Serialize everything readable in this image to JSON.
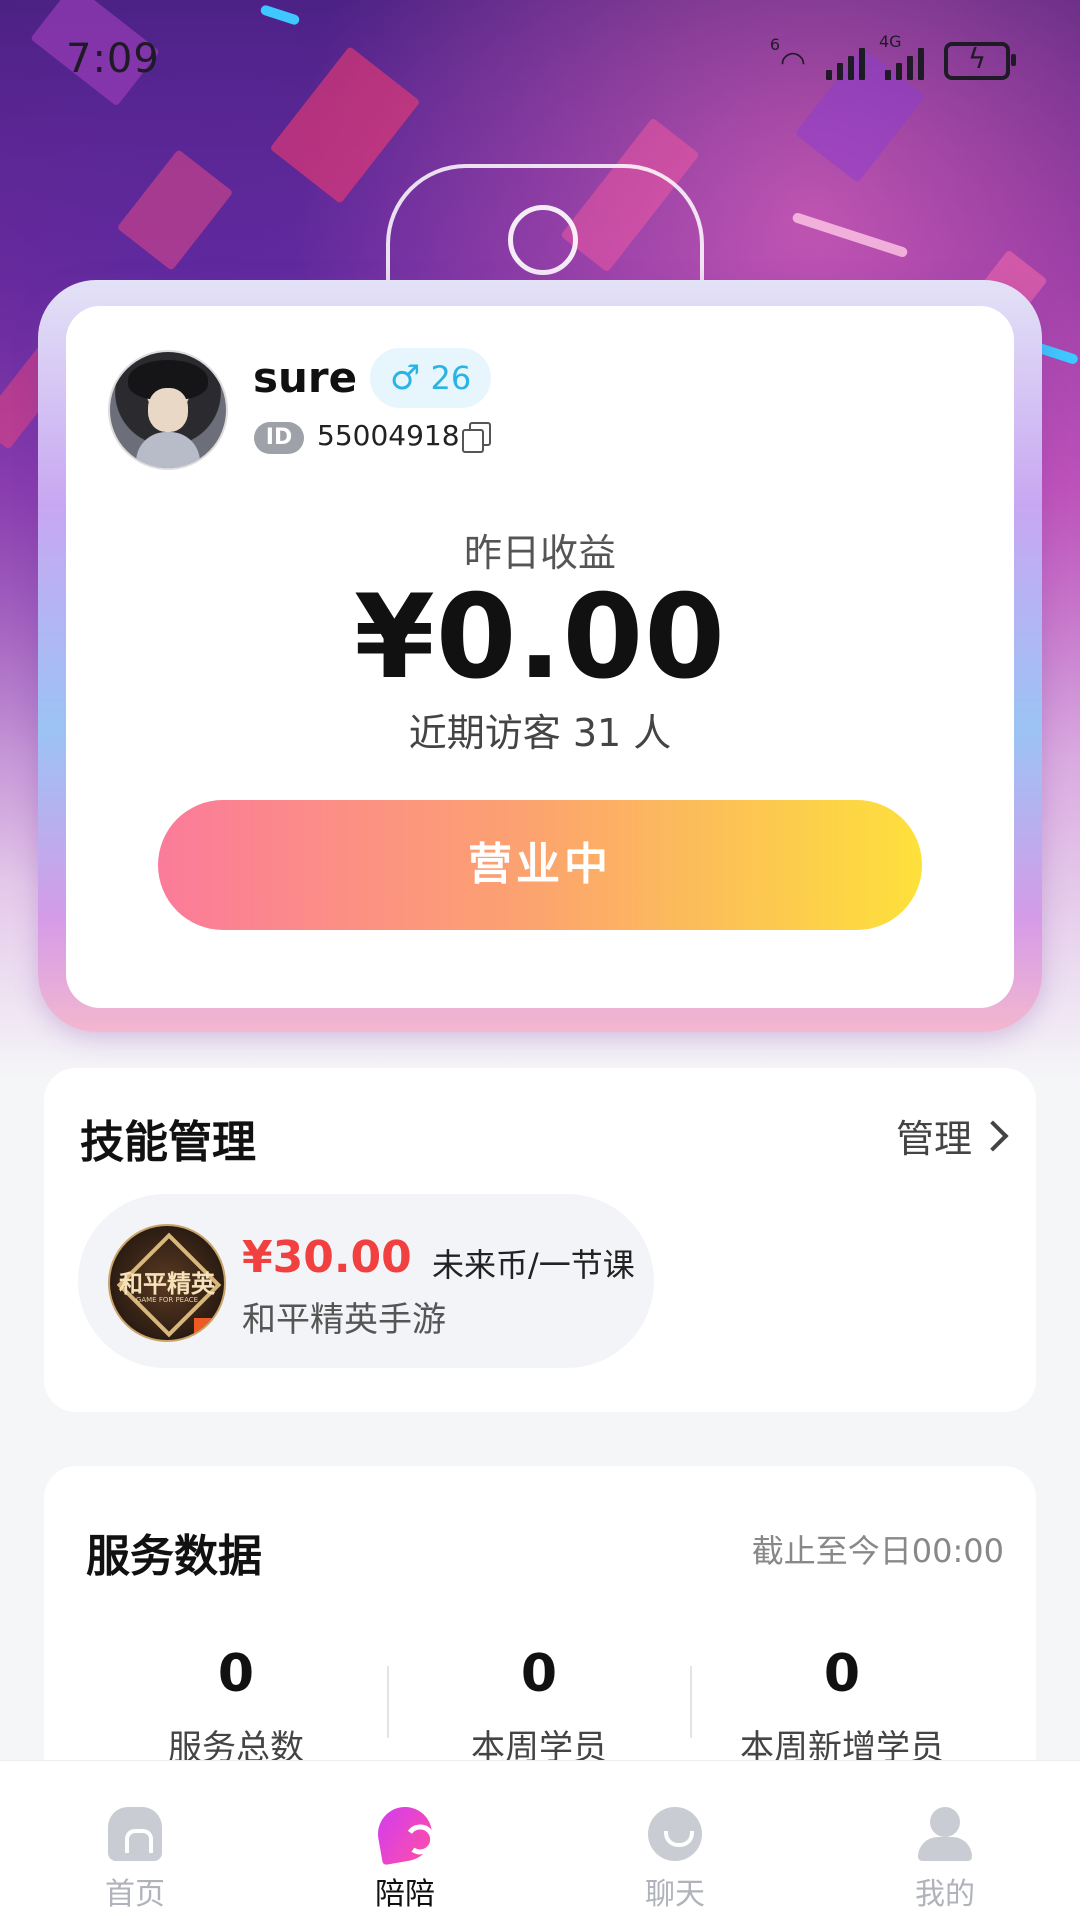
{
  "status_bar": {
    "time": "7:09",
    "network_label": "4G",
    "wifi_label": "6"
  },
  "profile": {
    "username": "sure",
    "gender_symbol": "♂",
    "age": "26",
    "id_tag": "ID",
    "id_value": "55004918"
  },
  "earnings": {
    "label": "昨日收益",
    "value": "¥0.00",
    "visitors_text": "近期访客 31 人"
  },
  "open_button_label": "营业中",
  "skills": {
    "title": "技能管理",
    "manage_label": "管理",
    "item": {
      "price": "¥30.00",
      "unit": "未来币/一节课",
      "game_name": "和平精英手游",
      "icon_text": "和平精英",
      "icon_subtext": "GAME FOR PEACE"
    }
  },
  "service": {
    "title": "服务数据",
    "cutoff": "截止至今日00:00",
    "stats": [
      {
        "value": "0",
        "label": "服务总数"
      },
      {
        "value": "0",
        "label": "本周学员"
      },
      {
        "value": "0",
        "label": "本周新增学员"
      }
    ]
  },
  "nav": {
    "items": [
      {
        "label": "首页",
        "icon": "home-icon",
        "active": false
      },
      {
        "label": "陪陪",
        "icon": "heart-chat-icon",
        "active": true
      },
      {
        "label": "聊天",
        "icon": "chat-icon",
        "active": false
      },
      {
        "label": "我的",
        "icon": "profile-icon",
        "active": false
      }
    ]
  },
  "colors": {
    "accent_gradient": [
      "#fb7b9a",
      "#fca46e",
      "#fde13b"
    ],
    "price_red": "#f04040",
    "gender_blue": "#2bb3e6",
    "nav_active": "#d13cf0"
  }
}
